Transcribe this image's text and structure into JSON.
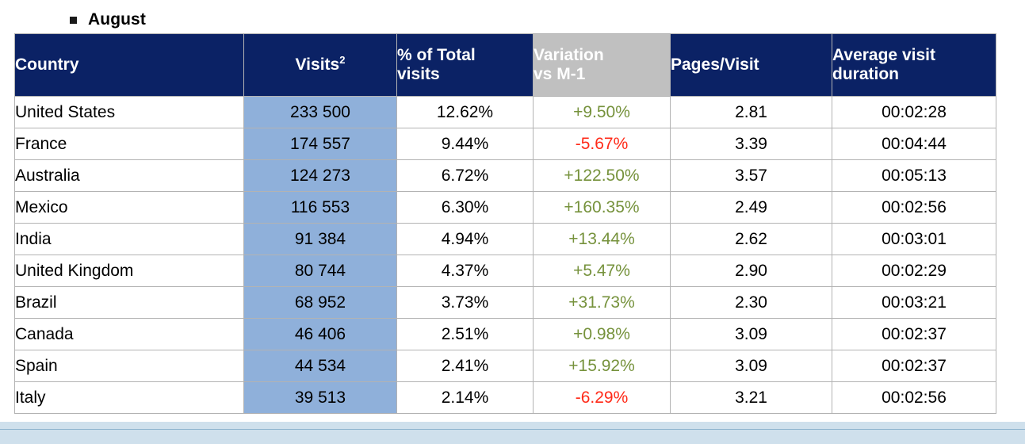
{
  "heading": {
    "bullet_icon": "square-bullet-icon",
    "label": "August"
  },
  "table": {
    "columns": [
      {
        "label": "Country",
        "sup": "",
        "style": "navy"
      },
      {
        "label": "Visits",
        "sup": "2",
        "style": "navy"
      },
      {
        "label": "% of Total visits",
        "sup": "",
        "style": "navy"
      },
      {
        "label": "Variation vs M-1",
        "sup": "",
        "style": "gray"
      },
      {
        "label": "Pages/Visit",
        "sup": "",
        "style": "navy"
      },
      {
        "label": "Average visit duration",
        "sup": "",
        "style": "navy"
      }
    ],
    "column_labels": {
      "country": "Country",
      "visits": "Visits",
      "visits_sup": "2",
      "pct_line1": "% of Total",
      "pct_line2": "visits",
      "variation_line1": "Variation",
      "variation_line2": "vs M-1",
      "pages": "Pages/Visit",
      "duration_line1": "Average visit",
      "duration_line2": "duration"
    },
    "rows": [
      {
        "country": "United States",
        "visits": "233 500",
        "pct": "12.62%",
        "variation": "+9.50%",
        "variation_sign": "pos",
        "pages": "2.81",
        "duration": "00:02:28"
      },
      {
        "country": "France",
        "visits": "174 557",
        "pct": "9.44%",
        "variation": "-5.67%",
        "variation_sign": "neg",
        "pages": "3.39",
        "duration": "00:04:44"
      },
      {
        "country": "Australia",
        "visits": "124 273",
        "pct": "6.72%",
        "variation": "+122.50%",
        "variation_sign": "pos",
        "pages": "3.57",
        "duration": "00:05:13"
      },
      {
        "country": "Mexico",
        "visits": "116 553",
        "pct": "6.30%",
        "variation": "+160.35%",
        "variation_sign": "pos",
        "pages": "2.49",
        "duration": "00:02:56"
      },
      {
        "country": "India",
        "visits": "91 384",
        "pct": "4.94%",
        "variation": "+13.44%",
        "variation_sign": "pos",
        "pages": "2.62",
        "duration": "00:03:01"
      },
      {
        "country": "United Kingdom",
        "visits": "80 744",
        "pct": "4.37%",
        "variation": "+5.47%",
        "variation_sign": "pos",
        "pages": "2.90",
        "duration": "00:02:29"
      },
      {
        "country": "Brazil",
        "visits": "68 952",
        "pct": "3.73%",
        "variation": "+31.73%",
        "variation_sign": "pos",
        "pages": "2.30",
        "duration": "00:03:21"
      },
      {
        "country": "Canada",
        "visits": "46 406",
        "pct": "2.51%",
        "variation": "+0.98%",
        "variation_sign": "pos",
        "pages": "3.09",
        "duration": "00:02:37"
      },
      {
        "country": "Spain",
        "visits": "44 534",
        "pct": "2.41%",
        "variation": "+15.92%",
        "variation_sign": "pos",
        "pages": "3.09",
        "duration": "00:02:37"
      },
      {
        "country": "Italy",
        "visits": "39 513",
        "pct": "2.14%",
        "variation": "-6.29%",
        "variation_sign": "neg",
        "pages": "3.21",
        "duration": "00:02:56"
      }
    ]
  },
  "colors": {
    "header_navy": "#0b2265",
    "header_gray": "#c0c0c0",
    "visits_cell_blue": "#8fb0da",
    "positive_green": "#76923c",
    "negative_red": "#ff2a18",
    "grid_border": "#b3b3b3",
    "footer_band": "#cfe0ec",
    "footer_rule": "#8cb3cd"
  }
}
